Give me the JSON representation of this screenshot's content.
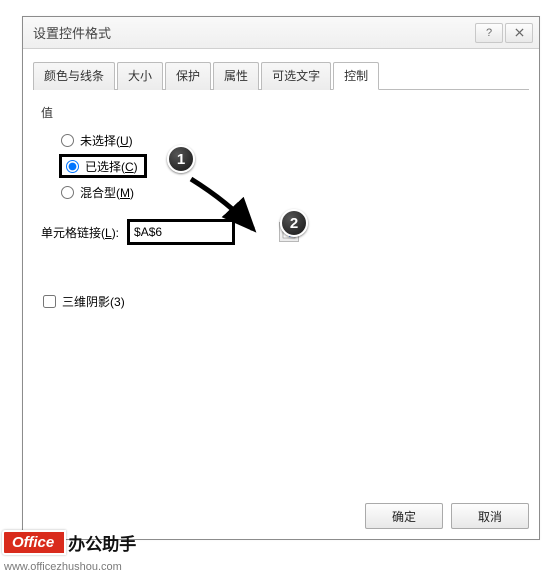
{
  "dialog": {
    "title": "设置控件格式"
  },
  "tabs": [
    {
      "label": "颜色与线条"
    },
    {
      "label": "大小"
    },
    {
      "label": "保护"
    },
    {
      "label": "属性"
    },
    {
      "label": "可选文字"
    },
    {
      "label": "控制"
    }
  ],
  "section": {
    "value_label": "值",
    "radio_unselected": "未选择(",
    "radio_unselected_key": "U",
    "radio_unselected_close": ")",
    "radio_selected": "已选择(",
    "radio_selected_key": "C",
    "radio_selected_close": ")",
    "radio_mixed": "混合型(",
    "radio_mixed_key": "M",
    "radio_mixed_close": ")"
  },
  "link": {
    "label_pre": "单元格链接(",
    "label_key": "L",
    "label_post": "):",
    "value": "$A$6"
  },
  "shadow": {
    "label_pre": "三维阴影(",
    "label_key": "3",
    "label_post": ")"
  },
  "buttons": {
    "ok": "确定",
    "cancel": "取消"
  },
  "callouts": {
    "one": "1",
    "two": "2"
  },
  "watermark": {
    "brand": "Office",
    "suffix": "办公助手",
    "url": "www.officezhushou.com"
  }
}
